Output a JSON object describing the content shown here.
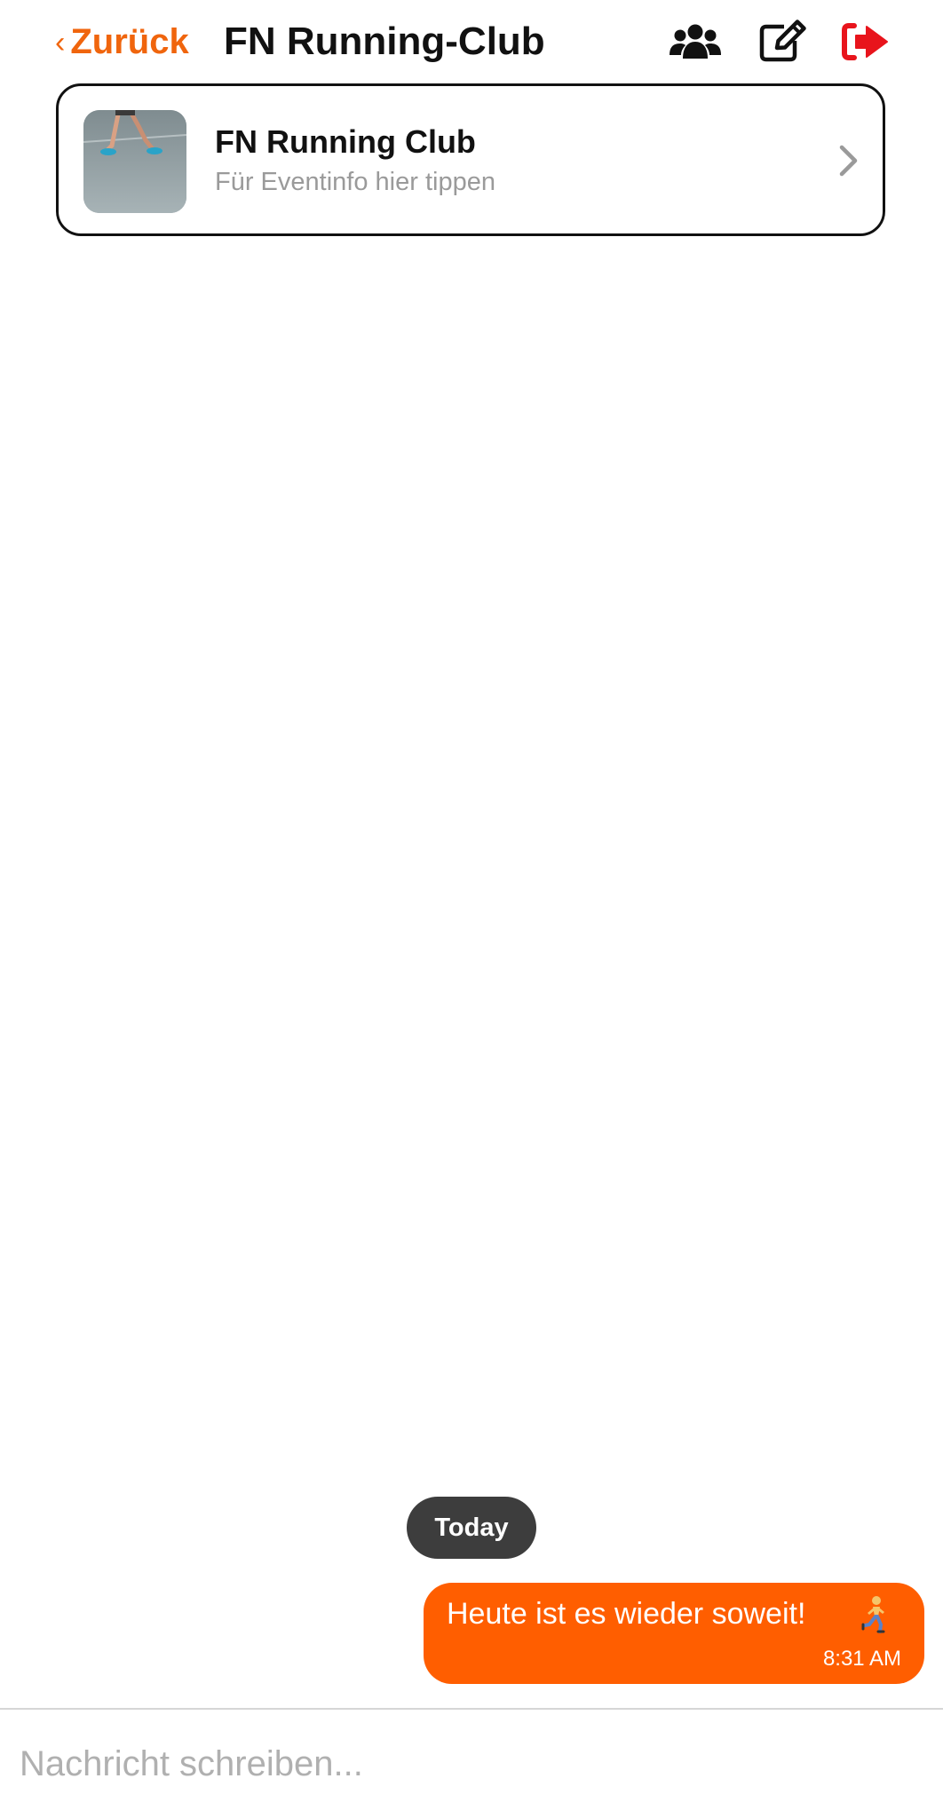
{
  "header": {
    "back_label": "Zurück",
    "back_chevron": "‹",
    "title": "FN Running-Club",
    "icons": [
      "users-group-icon",
      "edit-icon",
      "sign-out-icon"
    ]
  },
  "event_card": {
    "title": "FN Running Club",
    "subtitle": "Für Eventinfo hier tippen",
    "thumbnail": "runner-legs-photo"
  },
  "chat": {
    "date_separator": "Today",
    "messages": [
      {
        "direction": "outgoing",
        "text": "Heute ist es wieder soweit!",
        "emoji_icon": "running-person-icon",
        "time": "8:31 AM"
      }
    ]
  },
  "compose": {
    "placeholder": "Nachricht schreiben..."
  },
  "colors": {
    "accent": "#f0650d",
    "bubble": "#ff5e00",
    "leave_icon": "#e8141c",
    "date_pill": "#3d3d3d"
  }
}
